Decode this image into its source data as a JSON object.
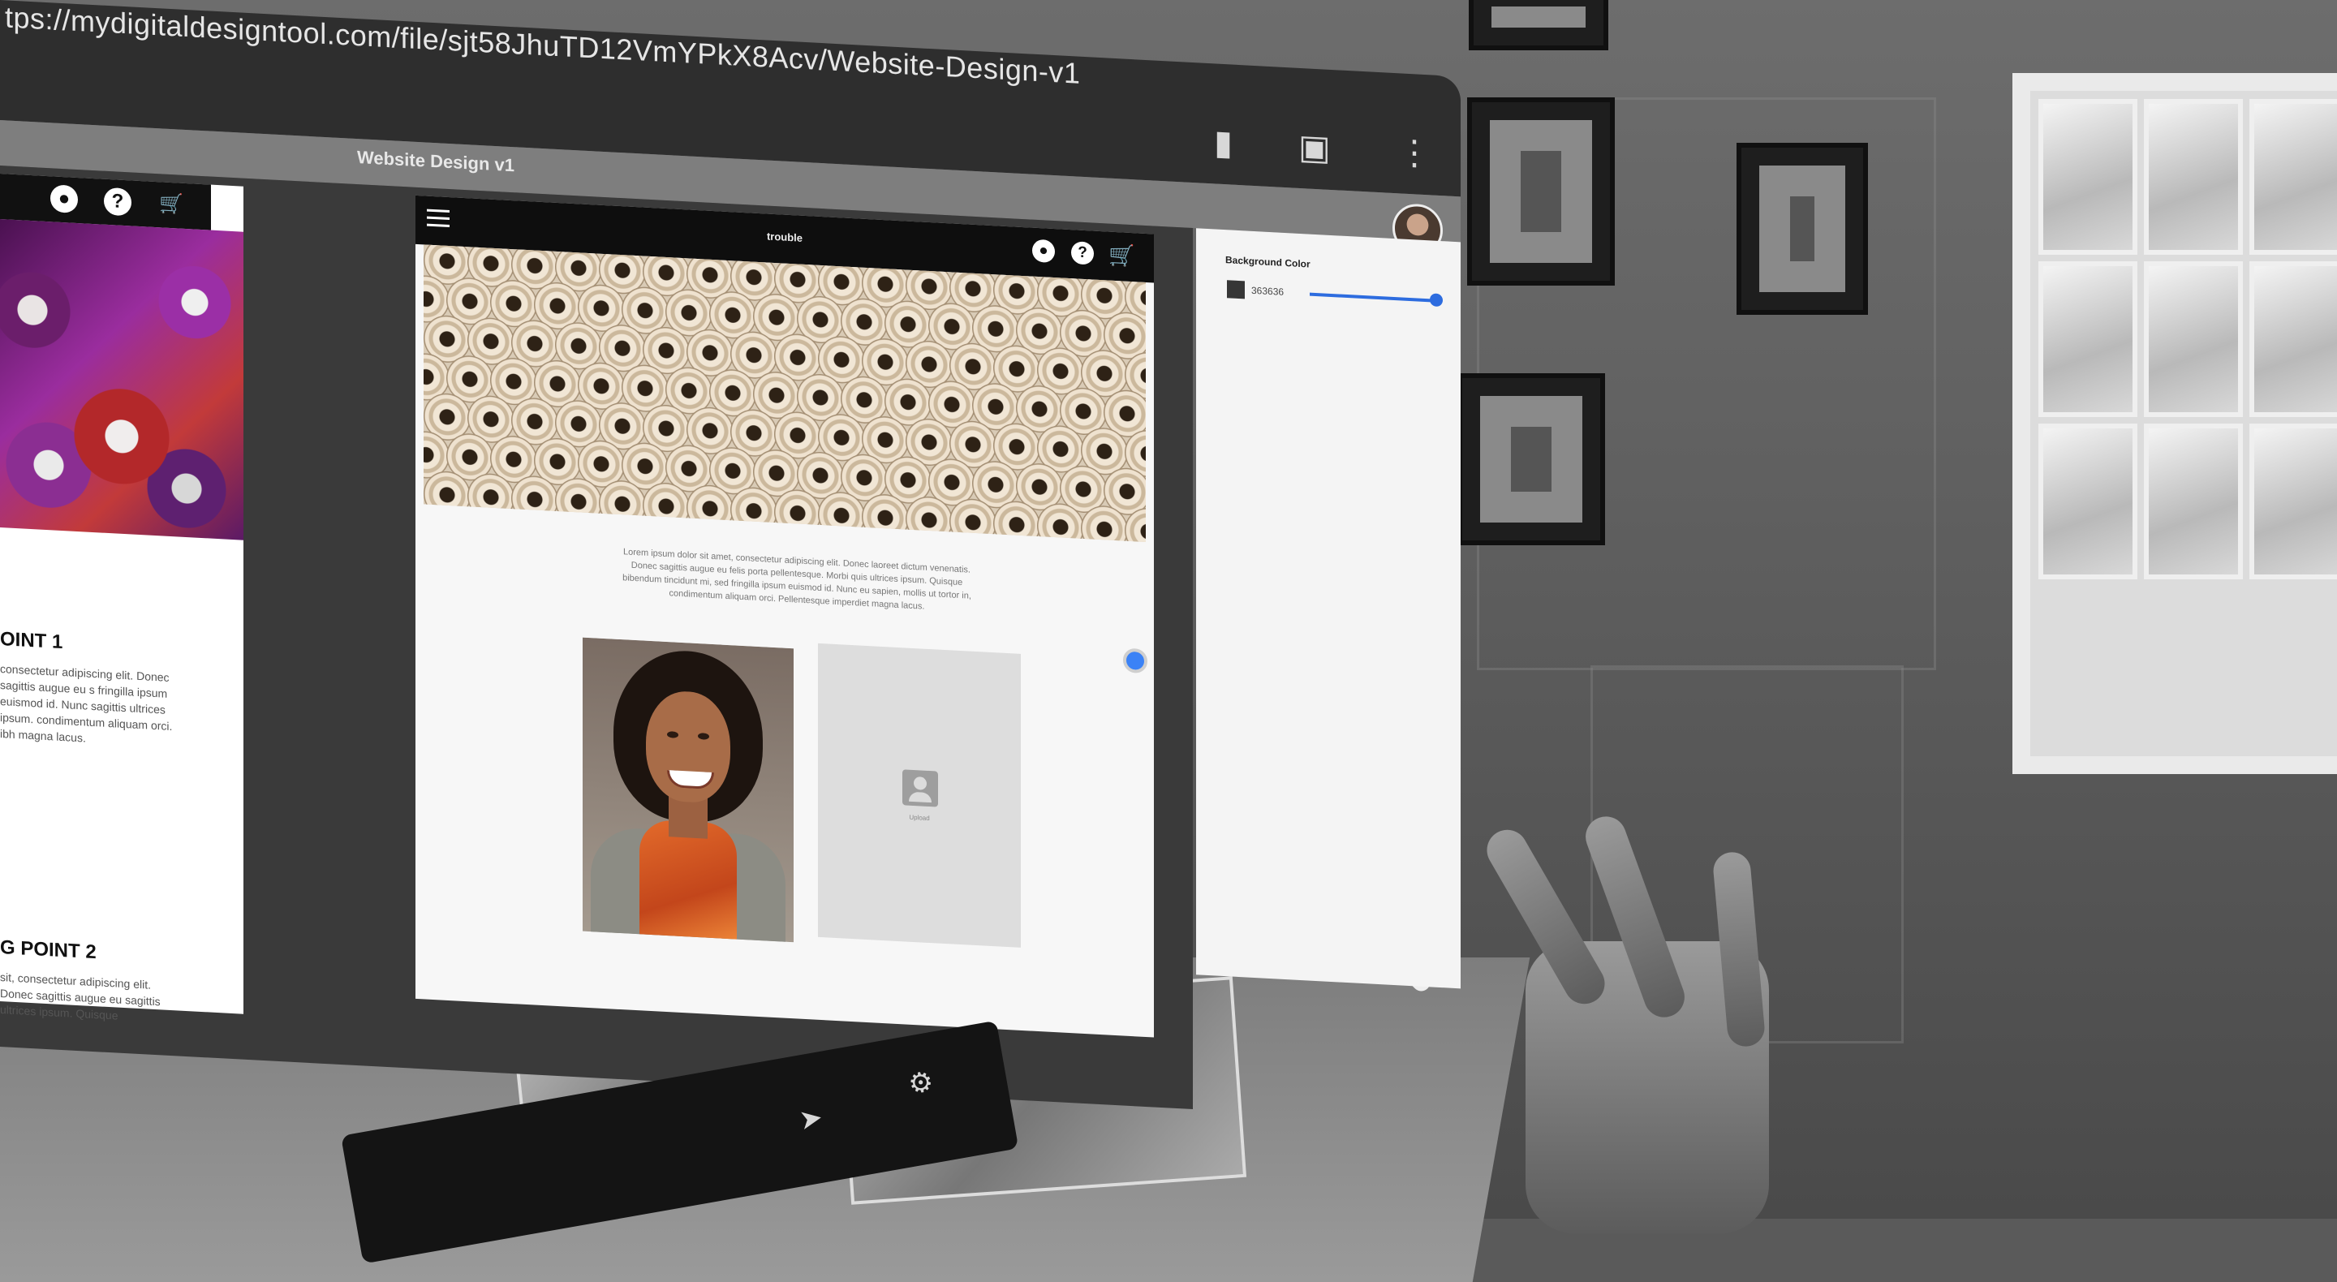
{
  "browser": {
    "url": "tps://mydigitaldesigntool.com/file/sjt58JhuTD12VmYPkX8Acv/Website-Design-v1",
    "document_title": "Website Design v1",
    "toolbar_icons": [
      "bookmark-icon",
      "screen-icon",
      "more-icon"
    ]
  },
  "left_page": {
    "point1_heading": "OINT 1",
    "point1_body": "consectetur adipiscing elit. Donec sagittis augue eu s fringilla ipsum euismod id. Nunc sagittis ultrices ipsum. condimentum aliquam orci. ibh magna lacus.",
    "point2_heading": "G POINT 2",
    "point2_body": "sit, consectetur adipiscing elit. Donec sagittis augue eu sagittis ultrices ipsum. Quisque"
  },
  "main_page": {
    "header_title": "trouble",
    "intro_text": "Lorem ipsum dolor sit amet, consectetur adipiscing elit. Donec laoreet dictum venenatis. Donec sagittis augue eu felis porta pellentesque. Morbi quis ultrices ipsum. Quisque bibendum tincidunt mi, sed fringilla ipsum euismod id. Nunc eu sapien, mollis ut tortor in, condimentum aliquam orci. Pellentesque imperdiet magna lacus.",
    "placeholder_caption": "Upload"
  },
  "properties_panel": {
    "label": "Background Color",
    "color_hex": "363636",
    "color_value": "#363636",
    "slider_value": 1.0
  },
  "bottom_toolbar": {
    "icons": [
      "share-icon",
      "settings-icon"
    ]
  }
}
